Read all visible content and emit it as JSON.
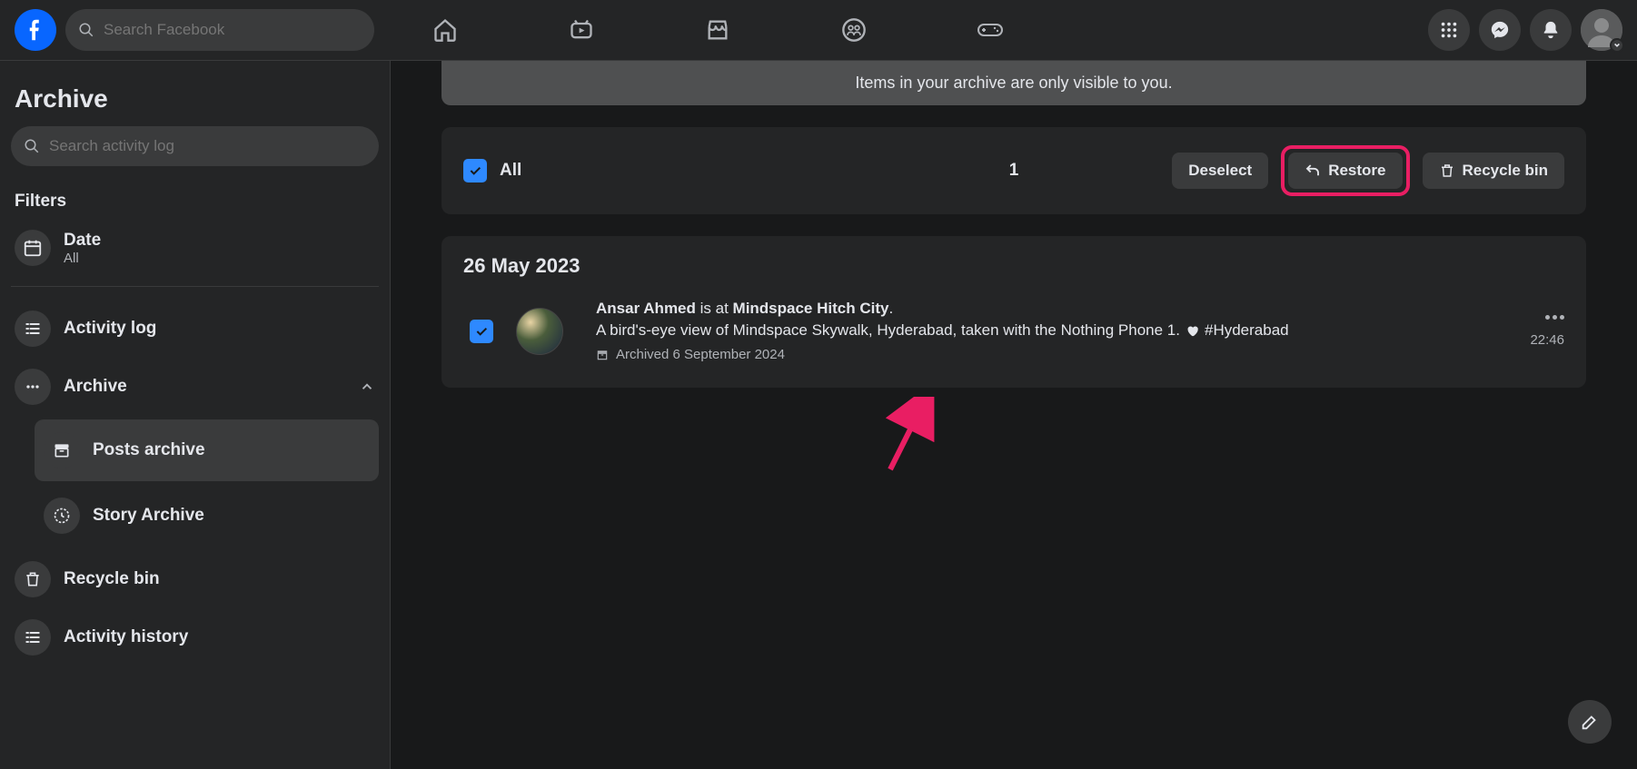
{
  "header": {
    "search_placeholder": "Search Facebook"
  },
  "sidebar": {
    "title": "Archive",
    "search_placeholder": "Search activity log",
    "filters_heading": "Filters",
    "date_filter": {
      "label": "Date",
      "value": "All"
    },
    "nav": {
      "activity_log": "Activity log",
      "archive": "Archive",
      "posts_archive": "Posts archive",
      "story_archive": "Story Archive",
      "recycle_bin": "Recycle bin",
      "activity_history": "Activity history"
    }
  },
  "main": {
    "info": "Items in your archive are only visible to you.",
    "all_label": "All",
    "selected_count": "1",
    "buttons": {
      "deselect": "Deselect",
      "restore": "Restore",
      "recycle_bin": "Recycle bin"
    },
    "date_heading": "26 May 2023",
    "post": {
      "name": "Ansar Ahmed",
      "connector": " is at ",
      "place": "Mindspace Hitch City",
      "punct": ".",
      "description_pre": "A bird's-eye view of Mindspace Skywalk, Hyderabad, taken with the Nothing Phone 1. ",
      "hashtag": "#Hyderabad",
      "archived_label": "Archived 6 September 2024",
      "time": "22:46"
    }
  }
}
